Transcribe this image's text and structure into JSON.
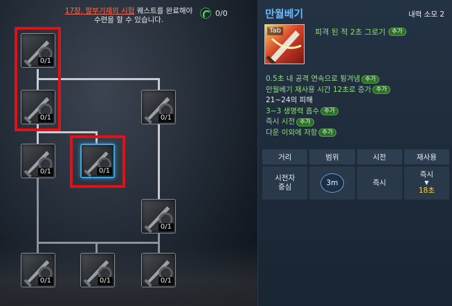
{
  "quest": {
    "highlight": "17장. 팔부기재의 시험",
    "line1_rest": " 퀘스트를 완료해야",
    "line2": "수련을 할 수 있습니다."
  },
  "points": {
    "value": "0/0",
    "icon": "swirl-icon"
  },
  "tree": {
    "nodes": [
      {
        "id": "r1c1",
        "count": "0/1"
      },
      {
        "id": "r2c1",
        "count": "0/1"
      },
      {
        "id": "r2c3",
        "count": "0/1"
      },
      {
        "id": "r3c1",
        "count": "0/1"
      },
      {
        "id": "r3c2",
        "count": "0/1"
      },
      {
        "id": "r4c3",
        "count": "0/1"
      },
      {
        "id": "r5c1",
        "count": "0/1"
      },
      {
        "id": "r5c2",
        "count": "0/1"
      },
      {
        "id": "r5c3",
        "count": "0/1"
      }
    ],
    "highlight_color": "#e01217",
    "selected_color": "#3aa8e6"
  },
  "detail": {
    "title": "만월베기",
    "cost": "내력 소모 2",
    "icon_key": "Tab",
    "tag_text": "피격 된 적 2초 그로기",
    "tag_pill": "추가",
    "effects": [
      {
        "text": "0.5초 내 공격 연속으로 튕겨냄",
        "pill": "추가",
        "color": "green"
      },
      {
        "text": "만월베기 재사용 시간 12초로 증가",
        "pill": "추가",
        "color": "green"
      },
      {
        "text": "21~24의 피해",
        "pill": "",
        "color": "white"
      },
      {
        "text": "3~3 생명력 흡수",
        "pill": "추가",
        "color": "green"
      },
      {
        "text": "즉시 시전",
        "pill": "추가",
        "color": "green"
      },
      {
        "text": "다운 이외에 저항",
        "pill": "추가",
        "color": "green"
      }
    ],
    "stats": {
      "headers": [
        "거리",
        "범위",
        "시전",
        "재사용"
      ],
      "distance_line1": "시전자",
      "distance_line2": "중심",
      "range": "3m",
      "cast": "즉시",
      "cooldown_from": "즉시",
      "cooldown_arrow": "▼",
      "cooldown_to": "18초"
    },
    "colors": {
      "title": "#69b9ff",
      "effect_green": "#8fe07c",
      "cooldown": "#ffd23a"
    }
  }
}
